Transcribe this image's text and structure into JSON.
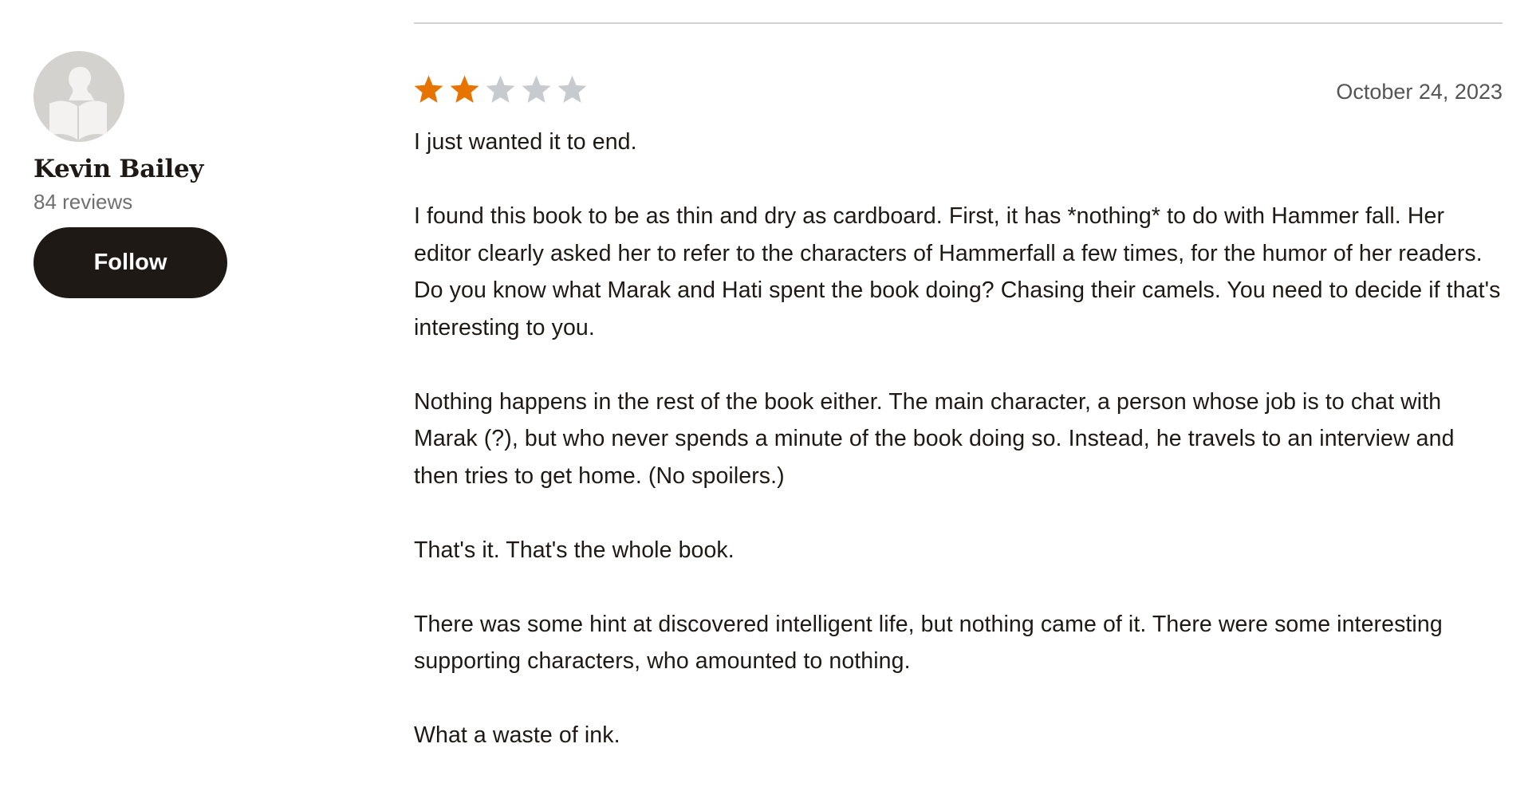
{
  "reviewer": {
    "name": "Kevin Bailey",
    "reviews_count": "84 reviews",
    "follow_label": "Follow",
    "avatar_icon": "default-reader-avatar-icon"
  },
  "review": {
    "rating": 2,
    "rating_max": 5,
    "date": "October 24, 2023",
    "paragraphs": [
      "I just wanted it to end.",
      "I found this book to be as thin and dry as cardboard. First, it has *nothing* to do with Hammer fall. Her editor clearly asked her to refer to the characters of Hammerfall a few times, for the humor of her readers. Do you know what Marak and Hati spent the book doing? Chasing their camels. You need to decide if that's interesting to you.",
      "Nothing happens in the rest of the book either. The main character, a person whose job is to chat with Marak (?), but who never spends a minute of the book doing so. Instead, he travels to an interview and then tries to get home. (No spoilers.)",
      "That's it. That's the whole book.",
      "There was some hint at discovered intelligent life, but nothing came of it. There were some interesting supporting characters, who amounted to nothing.",
      "What a waste of ink."
    ]
  },
  "colors": {
    "star_filled": "#e87400",
    "star_empty": "#c7cbd0",
    "button_bg": "#1e1915",
    "avatar_bg": "#d4d2cf"
  }
}
